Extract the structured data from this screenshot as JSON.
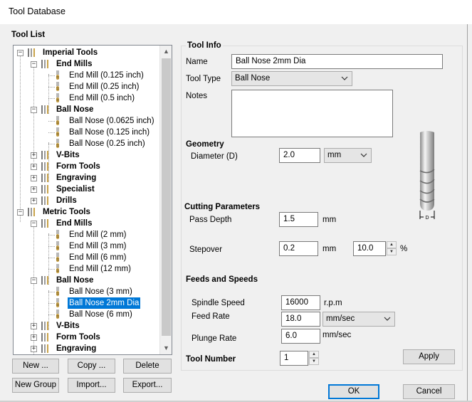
{
  "window": {
    "title": "Tool Database"
  },
  "tool_list": {
    "label": "Tool List",
    "rows": [
      {
        "text": "Imperial Tools",
        "kind": "group",
        "level": 0
      },
      {
        "text": "End Mills",
        "kind": "group",
        "level": 1
      },
      {
        "text": "End Mill (0.125 inch)",
        "kind": "tool",
        "level": 2
      },
      {
        "text": "End Mill (0.25 inch)",
        "kind": "tool",
        "level": 2
      },
      {
        "text": "End Mill (0.5 inch)",
        "kind": "tool",
        "level": 2
      },
      {
        "text": "Ball Nose",
        "kind": "group",
        "level": 1
      },
      {
        "text": "Ball Nose (0.0625 inch)",
        "kind": "tool",
        "level": 2
      },
      {
        "text": "Ball Nose (0.125 inch)",
        "kind": "tool",
        "level": 2
      },
      {
        "text": "Ball Nose (0.25 inch)",
        "kind": "tool",
        "level": 2
      },
      {
        "text": "V-Bits",
        "kind": "group-collapsed",
        "level": 1
      },
      {
        "text": "Form Tools",
        "kind": "group-collapsed",
        "level": 1
      },
      {
        "text": "Engraving",
        "kind": "group-collapsed",
        "level": 1
      },
      {
        "text": "Specialist",
        "kind": "group-collapsed",
        "level": 1
      },
      {
        "text": "Drills",
        "kind": "group-collapsed",
        "level": 1
      },
      {
        "text": "Metric Tools",
        "kind": "group",
        "level": 0
      },
      {
        "text": "End Mills",
        "kind": "group",
        "level": 1
      },
      {
        "text": "End Mill (2 mm)",
        "kind": "tool",
        "level": 2
      },
      {
        "text": "End Mill (3 mm)",
        "kind": "tool",
        "level": 2
      },
      {
        "text": "End Mill (6 mm)",
        "kind": "tool",
        "level": 2
      },
      {
        "text": "End Mill (12 mm)",
        "kind": "tool",
        "level": 2
      },
      {
        "text": "Ball Nose",
        "kind": "group",
        "level": 1
      },
      {
        "text": "Ball Nose (3 mm)",
        "kind": "tool",
        "level": 2
      },
      {
        "text": "Ball Nose 2mm Dia",
        "kind": "tool",
        "level": 2,
        "selected": true
      },
      {
        "text": "Ball Nose (6 mm)",
        "kind": "tool",
        "level": 2
      },
      {
        "text": "V-Bits",
        "kind": "group-collapsed",
        "level": 1
      },
      {
        "text": "Form Tools",
        "kind": "group-collapsed",
        "level": 1
      },
      {
        "text": "Engraving",
        "kind": "group-collapsed",
        "level": 1
      }
    ],
    "buttons": {
      "new": "New ...",
      "copy": "Copy ...",
      "delete": "Delete",
      "new_group": "New Group",
      "import": "Import...",
      "export": "Export..."
    }
  },
  "tool_info": {
    "label": "Tool Info",
    "name_label": "Name",
    "name_value": "Ball Nose 2mm Dia",
    "type_label": "Tool Type",
    "type_value": "Ball Nose",
    "notes_label": "Notes",
    "notes_value": ""
  },
  "geometry": {
    "label": "Geometry",
    "diameter_label": "Diameter (D)",
    "diameter_value": "2.0",
    "diameter_unit": "mm",
    "diagram_label": "D"
  },
  "cutting": {
    "label": "Cutting Parameters",
    "pass_depth_label": "Pass Depth",
    "pass_depth_value": "1.5",
    "pass_depth_unit": "mm",
    "stepover_label": "Stepover",
    "stepover_value": "0.2",
    "stepover_unit": "mm",
    "stepover_percent_value": "10.0",
    "stepover_percent_unit": "%"
  },
  "feeds": {
    "label": "Feeds and Speeds",
    "spindle_label": "Spindle Speed",
    "spindle_value": "16000",
    "spindle_unit": "r.p.m",
    "feed_label": "Feed Rate",
    "feed_value": "18.0",
    "feed_unit": "mm/sec",
    "plunge_label": "Plunge Rate",
    "plunge_value": "6.0",
    "plunge_unit": "mm/sec"
  },
  "tool_number": {
    "label": "Tool Number",
    "value": "1"
  },
  "actions": {
    "apply": "Apply",
    "ok": "OK",
    "cancel": "Cancel"
  },
  "colors": {
    "selection": "#0078d7",
    "tool_gold": "#c8a24a"
  }
}
